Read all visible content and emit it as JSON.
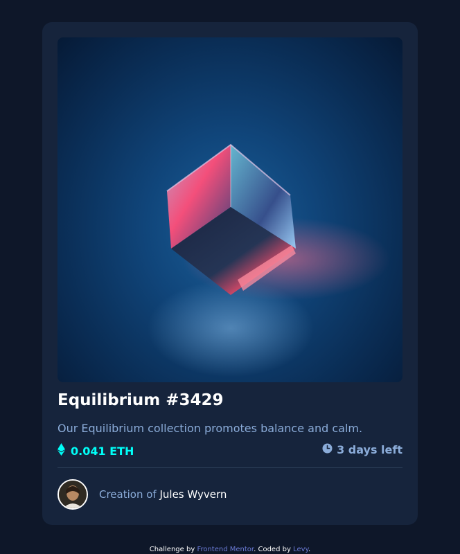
{
  "card": {
    "image_alt": "Equilibrium",
    "title": "Equilibrium #3429",
    "description": "Our Equilibrium collection promotes balance and calm.",
    "price": "0.041 ETH",
    "time_left": "3 days left",
    "creator_prefix": "Creation of",
    "creator_name": "Jules Wyvern"
  },
  "icons": {
    "price": "ethereum-icon",
    "time": "clock-icon"
  },
  "attribution": {
    "prefix": "Challenge by",
    "link1": "Frontend Mentor",
    "middle": ". Coded by",
    "link2": "Levy",
    "suffix": "."
  },
  "colors": {
    "page_background": "#0e1729",
    "card_background": "#16243c",
    "accent_cyan": "#00fff8",
    "soft_blue": "#8bacd9",
    "white": "#ffffff"
  }
}
